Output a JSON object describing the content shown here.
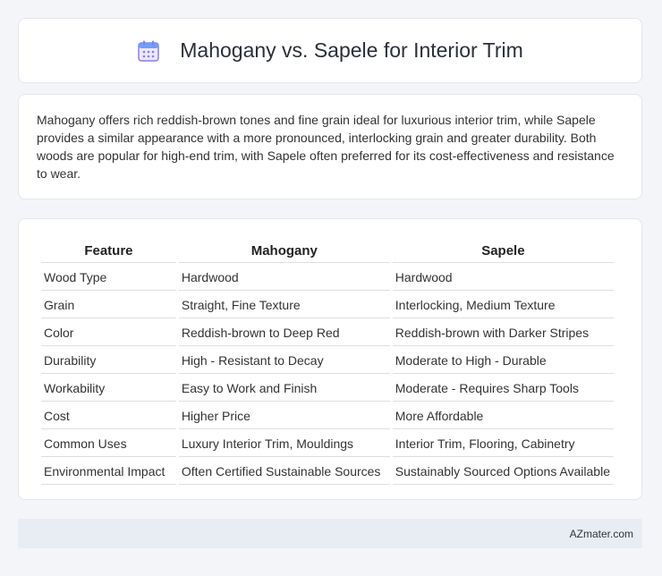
{
  "header": {
    "title": "Mahogany vs. Sapele for Interior Trim",
    "icon": "calendar-icon"
  },
  "description": "Mahogany offers rich reddish-brown tones and fine grain ideal for luxurious interior trim, while Sapele provides a similar appearance with a more pronounced, interlocking grain and greater durability. Both woods are popular for high-end trim, with Sapele often preferred for its cost-effectiveness and resistance to wear.",
  "table": {
    "headers": [
      "Feature",
      "Mahogany",
      "Sapele"
    ],
    "rows": [
      [
        "Wood Type",
        "Hardwood",
        "Hardwood"
      ],
      [
        "Grain",
        "Straight, Fine Texture",
        "Interlocking, Medium Texture"
      ],
      [
        "Color",
        "Reddish-brown to Deep Red",
        "Reddish-brown with Darker Stripes"
      ],
      [
        "Durability",
        "High - Resistant to Decay",
        "Moderate to High - Durable"
      ],
      [
        "Workability",
        "Easy to Work and Finish",
        "Moderate - Requires Sharp Tools"
      ],
      [
        "Cost",
        "Higher Price",
        "More Affordable"
      ],
      [
        "Common Uses",
        "Luxury Interior Trim, Mouldings",
        "Interior Trim, Flooring, Cabinetry"
      ],
      [
        "Environmental Impact",
        "Often Certified Sustainable Sources",
        "Sustainably Sourced Options Available"
      ]
    ]
  },
  "footer": {
    "site": "AZmater.com"
  },
  "colors": {
    "icon_accent": "#8a7cf0",
    "icon_header": "#6ea0f5"
  }
}
